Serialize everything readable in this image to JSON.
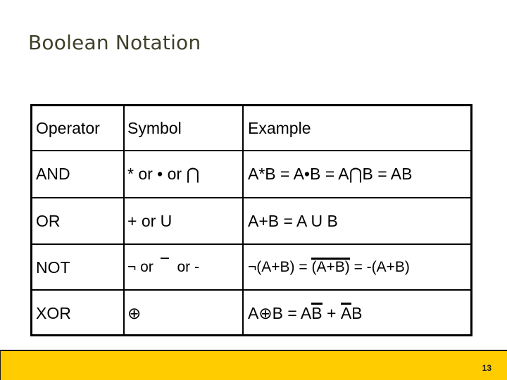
{
  "slide": {
    "title": "Boolean Notation",
    "page_number": "13",
    "footer_color": "#ffcc00",
    "title_color": "#3f3f2a"
  },
  "table": {
    "headers": [
      "Operator",
      "Symbol",
      "Example"
    ],
    "rows": [
      {
        "operator": "AND",
        "symbol": "* or • or ⋂",
        "example": "A*B = A•B = A⋂B = AB"
      },
      {
        "operator": "OR",
        "symbol": "+ or U",
        "example": "A+B = A U B"
      },
      {
        "operator": "NOT",
        "symbol_parts": [
          "¬ or ",
          "",
          " or -"
        ],
        "example_parts": [
          "¬(A+B) = ",
          "(A+B)",
          " = -(A+B)"
        ]
      },
      {
        "operator": "XOR",
        "symbol": "⊕",
        "example_parts": [
          "A⊕B = A",
          "B",
          " + ",
          "A",
          "B"
        ]
      }
    ]
  }
}
